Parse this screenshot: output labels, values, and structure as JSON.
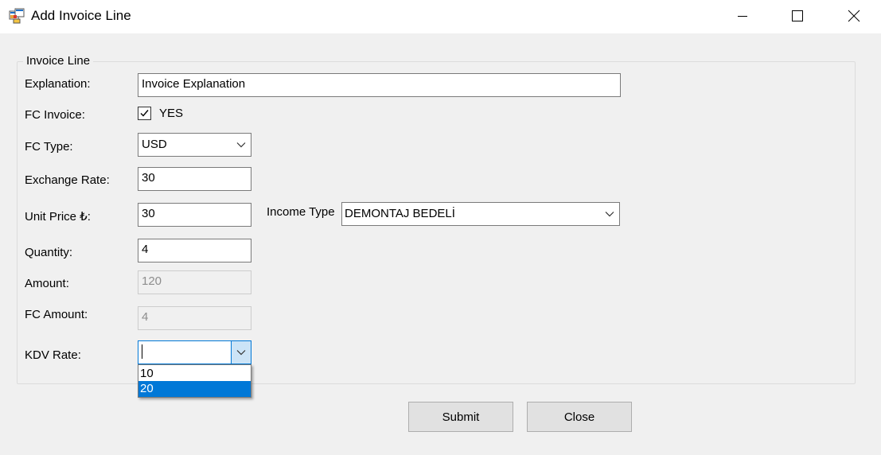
{
  "window": {
    "title": "Add Invoice Line",
    "app_icon": "windows-forms-app-icon",
    "controls": [
      "minimize-icon",
      "maximize-icon",
      "close-icon"
    ]
  },
  "group": {
    "title": "Invoice Line"
  },
  "fields": {
    "explanation": {
      "label": "Explanation:",
      "value": "Invoice Explanation"
    },
    "fc_invoice": {
      "label": "FC Invoice:",
      "checkbox_label": "YES",
      "checked": true
    },
    "fc_type": {
      "label": "FC Type:",
      "value": "USD"
    },
    "exchange_rate": {
      "label": "Exchange Rate:",
      "value": "30"
    },
    "unit_price": {
      "label": "Unit Price ₺:",
      "value": "30"
    },
    "income_type": {
      "label": "Income Type",
      "value": "DEMONTAJ BEDELİ"
    },
    "quantity": {
      "label": "Quantity:",
      "value": "4"
    },
    "amount": {
      "label": "Amount:",
      "value": "120"
    },
    "fc_amount": {
      "label": "FC Amount:",
      "value": "4"
    },
    "kdv_rate": {
      "label": "KDV Rate:",
      "value": "",
      "options": [
        "10",
        "20"
      ],
      "highlighted": "20"
    }
  },
  "buttons": {
    "submit": "Submit",
    "close": "Close"
  },
  "colors": {
    "selection": "#0078d7",
    "focus_border": "#0078d7",
    "button_face": "#e1e1e1"
  }
}
